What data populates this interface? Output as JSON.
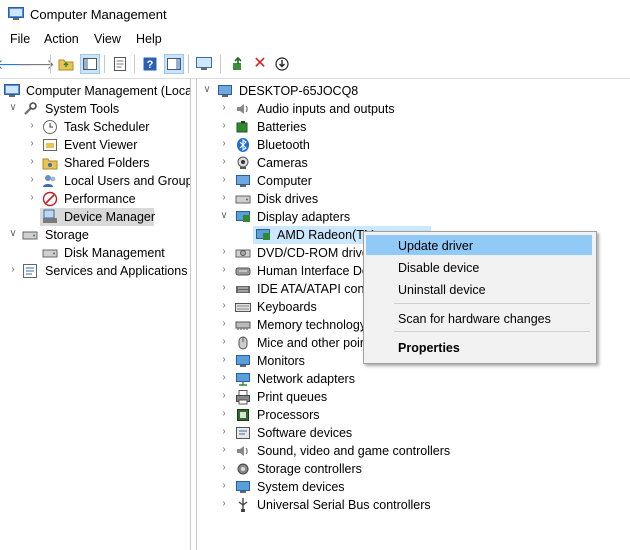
{
  "window": {
    "title": "Computer Management"
  },
  "menu": [
    "File",
    "Action",
    "View",
    "Help"
  ],
  "toolbar": {
    "buttons": [
      "back-arrow-icon",
      "forward-arrow-icon",
      "up-folder-icon",
      "show-hide-tree-icon",
      "properties-icon",
      "help-icon",
      "action-pane-icon",
      "monitor-icon",
      "update-driver-icon",
      "uninstall-icon",
      "download-icon"
    ]
  },
  "left_tree": {
    "root": "Computer Management (Local",
    "system_tools": "System Tools",
    "task_scheduler": "Task Scheduler",
    "event_viewer": "Event Viewer",
    "shared_folders": "Shared Folders",
    "local_users": "Local Users and Groups",
    "performance": "Performance",
    "device_manager": "Device Manager",
    "storage": "Storage",
    "disk_management": "Disk Management",
    "services": "Services and Applications"
  },
  "device_tree": {
    "computer_name": "DESKTOP-65JOCQ8",
    "categories": [
      "Audio inputs and outputs",
      "Batteries",
      "Bluetooth",
      "Cameras",
      "Computer",
      "Disk drives",
      "Display adapters",
      "AMD Radeon(TM",
      "DVD/CD-ROM drive",
      "Human Interface De",
      "IDE ATA/ATAPI contr",
      "Keyboards",
      "Memory technology",
      "Mice and other poir",
      "Monitors",
      "Network adapters",
      "Print queues",
      "Processors",
      "Software devices",
      "Sound, video and game controllers",
      "Storage controllers",
      "System devices",
      "Universal Serial Bus controllers"
    ]
  },
  "context_menu": {
    "update_driver": "Update driver",
    "disable_device": "Disable device",
    "uninstall_device": "Uninstall device",
    "scan_hardware": "Scan for hardware changes",
    "properties": "Properties"
  },
  "colors": {
    "selection": "#d9d9d9",
    "menu_highlight": "#91c9f7",
    "toolbar_active": "#cce4f7"
  }
}
